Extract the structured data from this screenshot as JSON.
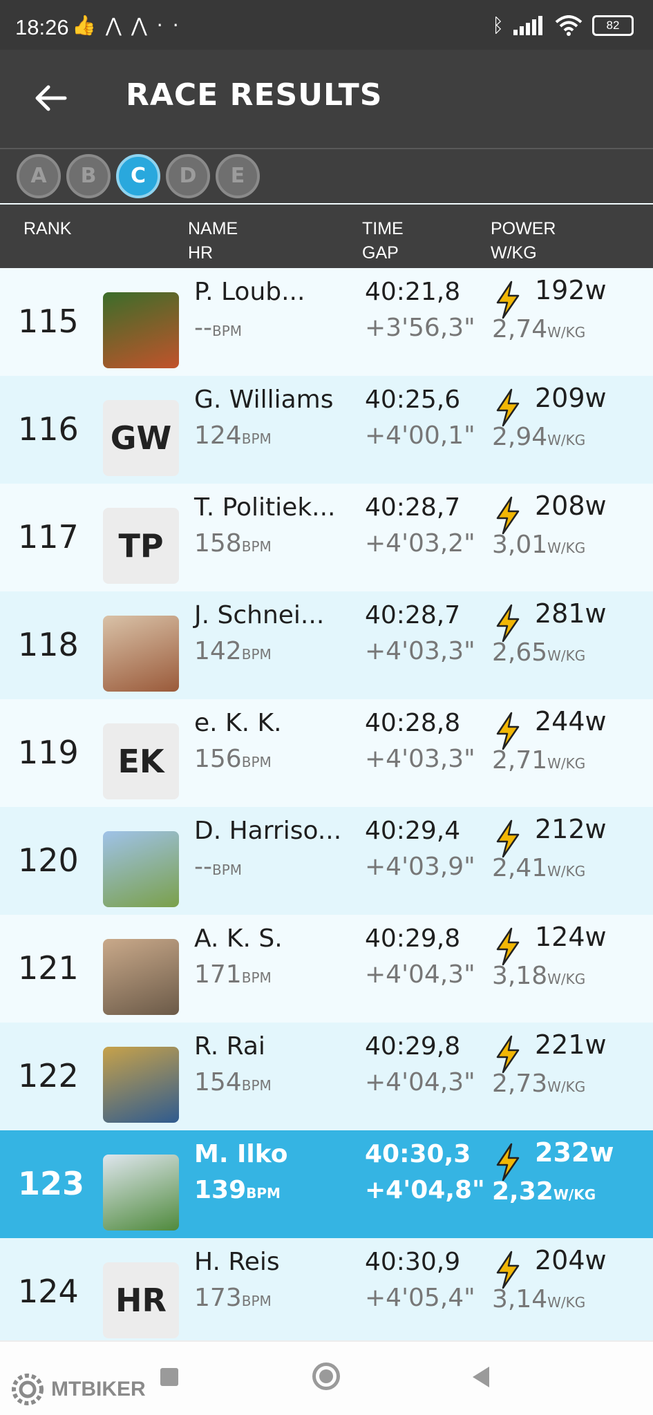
{
  "status_bar": {
    "time": "18:26",
    "battery": "82"
  },
  "header": {
    "title": "RACE RESULTS"
  },
  "category_tabs": [
    {
      "label": "A",
      "active": false
    },
    {
      "label": "B",
      "active": false
    },
    {
      "label": "C",
      "active": true
    },
    {
      "label": "D",
      "active": false
    },
    {
      "label": "E",
      "active": false
    }
  ],
  "columns": {
    "rank": "RANK",
    "name": "NAME",
    "hr": "HR",
    "time": "TIME",
    "gap": "GAP",
    "power": "POWER",
    "wkg": "W/KG"
  },
  "units": {
    "bpm": "BPM",
    "w": "w",
    "wkg": "W/KG"
  },
  "results": [
    {
      "rank": "115",
      "name": "P. Loub...",
      "hr": "--",
      "time": "40:21,8",
      "gap": "+3'56,3\"",
      "watts": "192",
      "wkg": "2,74",
      "avatar": "photo-rider-trainer"
    },
    {
      "rank": "116",
      "name": "G. Williams",
      "hr": "124",
      "time": "40:25,6",
      "gap": "+4'00,1\"",
      "watts": "209",
      "wkg": "2,94",
      "initials": "GW"
    },
    {
      "rank": "117",
      "name": "T. Politiek...",
      "hr": "158",
      "time": "40:28,7",
      "gap": "+4'03,2\"",
      "watts": "208",
      "wkg": "3,01",
      "initials": "TP"
    },
    {
      "rank": "118",
      "name": "J. Schnei...",
      "hr": "142",
      "time": "40:28,7",
      "gap": "+4'03,3\"",
      "watts": "281",
      "wkg": "2,65",
      "avatar": "photo-food"
    },
    {
      "rank": "119",
      "name": "e. K. K.",
      "hr": "156",
      "time": "40:28,8",
      "gap": "+4'03,3\"",
      "watts": "244",
      "wkg": "2,71",
      "initials": "EK"
    },
    {
      "rank": "120",
      "name": "D. Harriso...",
      "hr": "--",
      "time": "40:29,4",
      "gap": "+4'03,9\"",
      "watts": "212",
      "wkg": "2,41",
      "avatar": "photo-bicycle"
    },
    {
      "rank": "121",
      "name": "A. K. S.",
      "hr": "171",
      "time": "40:29,8",
      "gap": "+4'04,3\"",
      "watts": "124",
      "wkg": "3,18",
      "avatar": "photo-portrait"
    },
    {
      "rank": "122",
      "name": "R. Rai",
      "hr": "154",
      "time": "40:29,8",
      "gap": "+4'04,3\"",
      "watts": "221",
      "wkg": "2,73",
      "avatar": "photo-mtb-rider"
    },
    {
      "rank": "123",
      "name": "M. Ilko",
      "hr": "139",
      "time": "40:30,3",
      "gap": "+4'04,8\"",
      "watts": "232",
      "wkg": "2,32",
      "avatar": "photo-helmet-rider",
      "highlight": true
    },
    {
      "rank": "124",
      "name": "H. Reis",
      "hr": "173",
      "time": "40:30,9",
      "gap": "+4'05,4\"",
      "watts": "204",
      "wkg": "3,14",
      "initials": "HR"
    }
  ],
  "watermark": "MTBIKER",
  "colors": {
    "highlight": "#35b4e3",
    "header_bg": "#3f3f3f",
    "bolt": "#f2b705"
  }
}
